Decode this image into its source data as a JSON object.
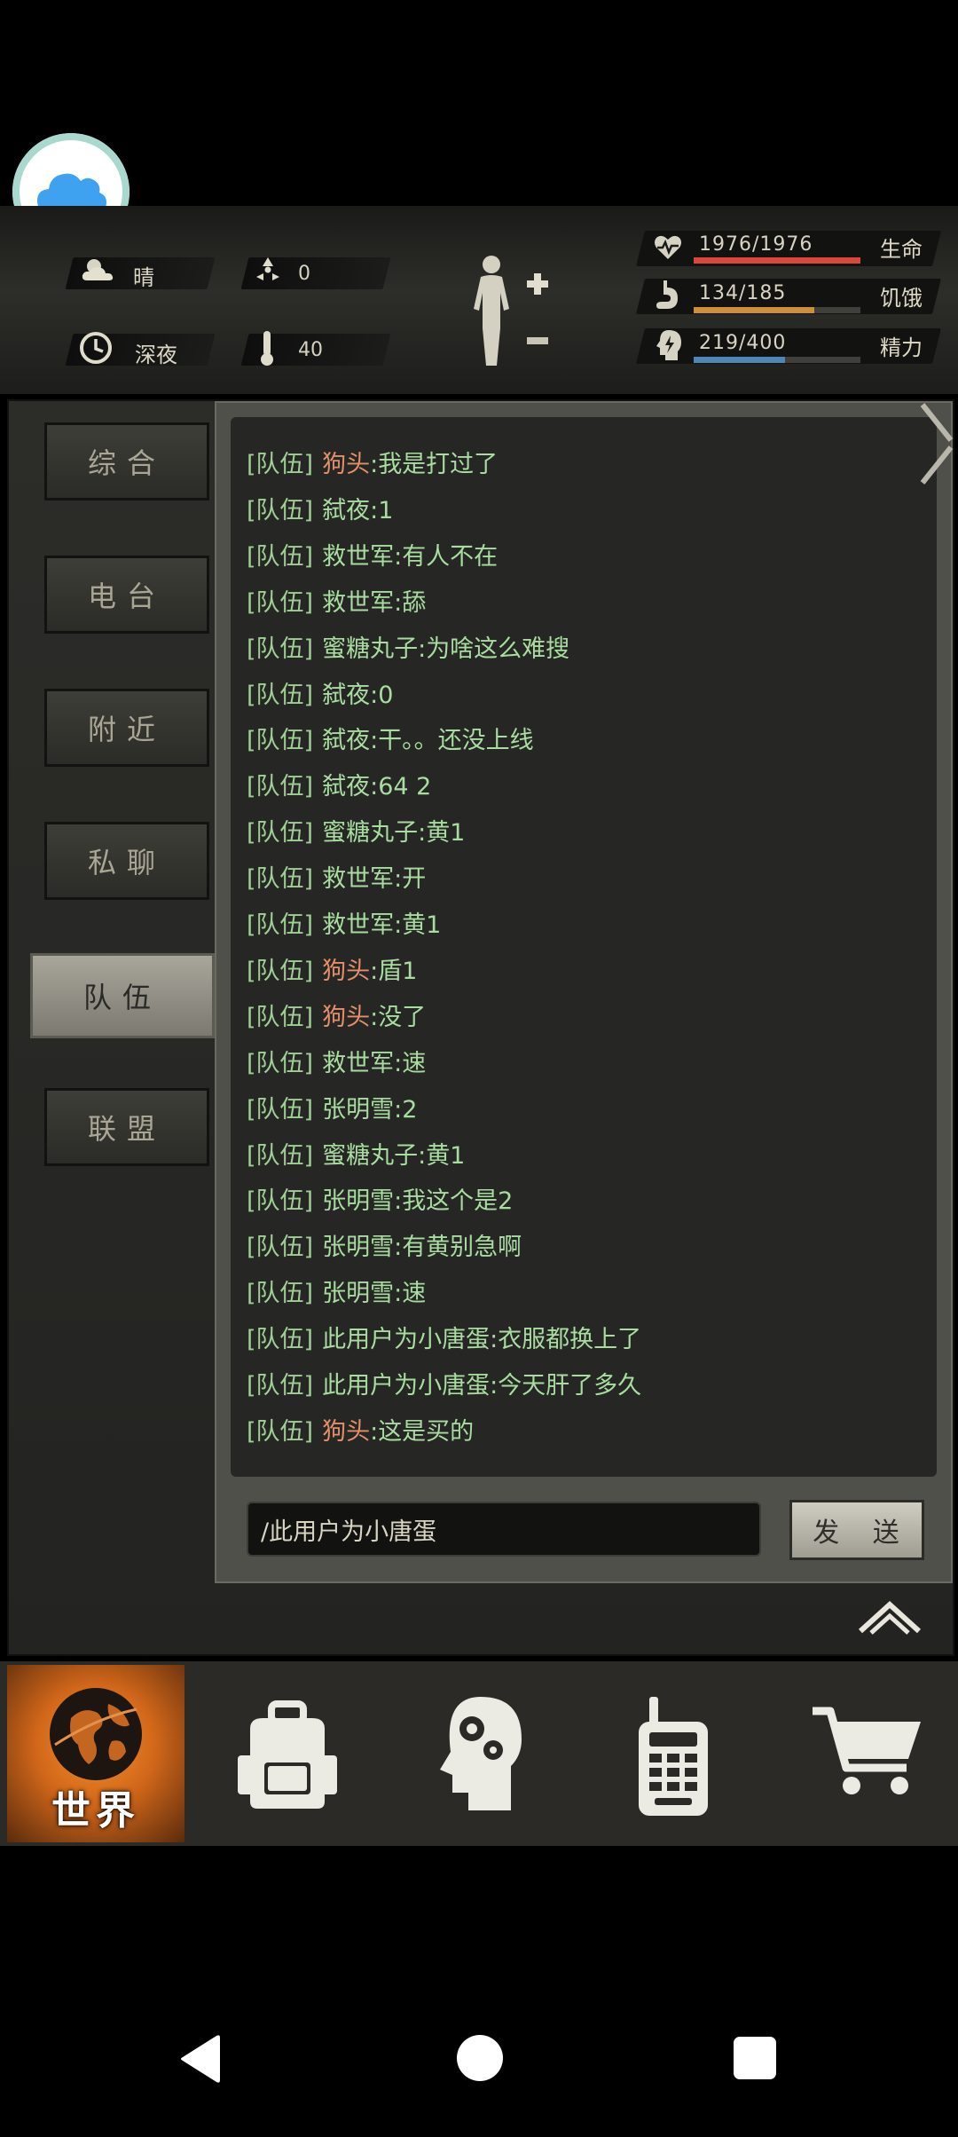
{
  "status": {
    "weather": "晴",
    "radiation": "0",
    "time_of_day": "深夜",
    "temperature": "40",
    "health": {
      "label": "生命",
      "value": "1976/1976",
      "fraction": 1.0,
      "color": "#d9493b"
    },
    "hunger": {
      "label": "饥饿",
      "value": "134/185",
      "fraction": 0.724,
      "color": "#cf8f3a"
    },
    "energy": {
      "label": "精力",
      "value": "219/400",
      "fraction": 0.5475,
      "color": "#4d86b8"
    }
  },
  "tabs": [
    {
      "label": "综合",
      "active": false
    },
    {
      "label": "电台",
      "active": false
    },
    {
      "label": "附近",
      "active": false
    },
    {
      "label": "私聊",
      "active": false
    },
    {
      "label": "队伍",
      "active": true
    },
    {
      "label": "联盟",
      "active": false
    }
  ],
  "messages": [
    {
      "channel": "[队伍]",
      "user": "狗头",
      "text": "我是打过了",
      "highlight": true
    },
    {
      "channel": "[队伍]",
      "user": "弑夜",
      "text": "1",
      "highlight": false
    },
    {
      "channel": "[队伍]",
      "user": "救世军",
      "text": "有人不在",
      "highlight": false
    },
    {
      "channel": "[队伍]",
      "user": "救世军",
      "text": "舔",
      "highlight": false
    },
    {
      "channel": "[队伍]",
      "user": "蜜糖丸子",
      "text": "为啥这么难搜",
      "highlight": false
    },
    {
      "channel": "[队伍]",
      "user": "弑夜",
      "text": "0",
      "highlight": false
    },
    {
      "channel": "[队伍]",
      "user": "弑夜",
      "text": "干。。还没上线",
      "highlight": false
    },
    {
      "channel": "[队伍]",
      "user": "弑夜",
      "text": "64 2",
      "highlight": false
    },
    {
      "channel": "[队伍]",
      "user": "蜜糖丸子",
      "text": "黄1",
      "highlight": false
    },
    {
      "channel": "[队伍]",
      "user": "救世军",
      "text": "开",
      "highlight": false
    },
    {
      "channel": "[队伍]",
      "user": "救世军",
      "text": "黄1",
      "highlight": false
    },
    {
      "channel": "[队伍]",
      "user": "狗头",
      "text": "盾1",
      "highlight": true
    },
    {
      "channel": "[队伍]",
      "user": "狗头",
      "text": "没了",
      "highlight": true
    },
    {
      "channel": "[队伍]",
      "user": "救世军",
      "text": "速",
      "highlight": false
    },
    {
      "channel": "[队伍]",
      "user": "张明雪",
      "text": "2",
      "highlight": false
    },
    {
      "channel": "[队伍]",
      "user": "蜜糖丸子",
      "text": "黄1",
      "highlight": false
    },
    {
      "channel": "[队伍]",
      "user": "张明雪",
      "text": "我这个是2",
      "highlight": false
    },
    {
      "channel": "[队伍]",
      "user": "张明雪",
      "text": "有黄别急啊",
      "highlight": false
    },
    {
      "channel": "[队伍]",
      "user": "张明雪",
      "text": "速",
      "highlight": false
    },
    {
      "channel": "[队伍]",
      "user": "此用户为小唐蛋",
      "text": "衣服都换上了",
      "highlight": false
    },
    {
      "channel": "[队伍]",
      "user": "此用户为小唐蛋",
      "text": "今天肝了多久",
      "highlight": false
    },
    {
      "channel": "[队伍]",
      "user": "狗头",
      "text": "这是买的",
      "highlight": true
    }
  ],
  "chat_input": {
    "value": "/此用户为小唐蛋"
  },
  "send_label": "发 送",
  "nav": {
    "world_label": "世界",
    "items": [
      "globe-icon",
      "backpack-icon",
      "skills-head-icon",
      "radio-icon",
      "cart-icon"
    ]
  }
}
